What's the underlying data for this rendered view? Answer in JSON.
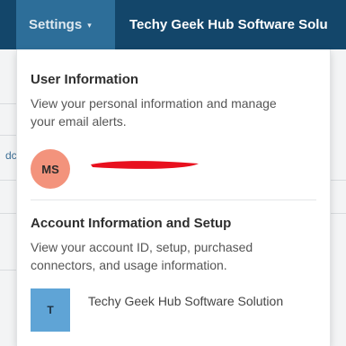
{
  "topbar": {
    "settings_label": "Settings",
    "settings_caret": "▾",
    "org_name": "Techy Geek Hub Software Solu"
  },
  "background": {
    "fragment": "dc"
  },
  "dropdown": {
    "user_section": {
      "title": "User Information",
      "description": "View your personal information and manage your email alerts.",
      "avatar_initials": "MS",
      "name_redacted": true
    },
    "account_section": {
      "title": "Account Information and Setup",
      "description": "View your account ID, setup, purchased connectors, and usage information.",
      "org_initial": "T",
      "org_name": "Techy Geek Hub Software Solution"
    }
  },
  "colors": {
    "topbar": "#13466a",
    "settings_tab": "#2d6e99",
    "avatar": "#f3937c",
    "org_avatar": "#5fa4d6",
    "redaction": "#e8101e"
  }
}
